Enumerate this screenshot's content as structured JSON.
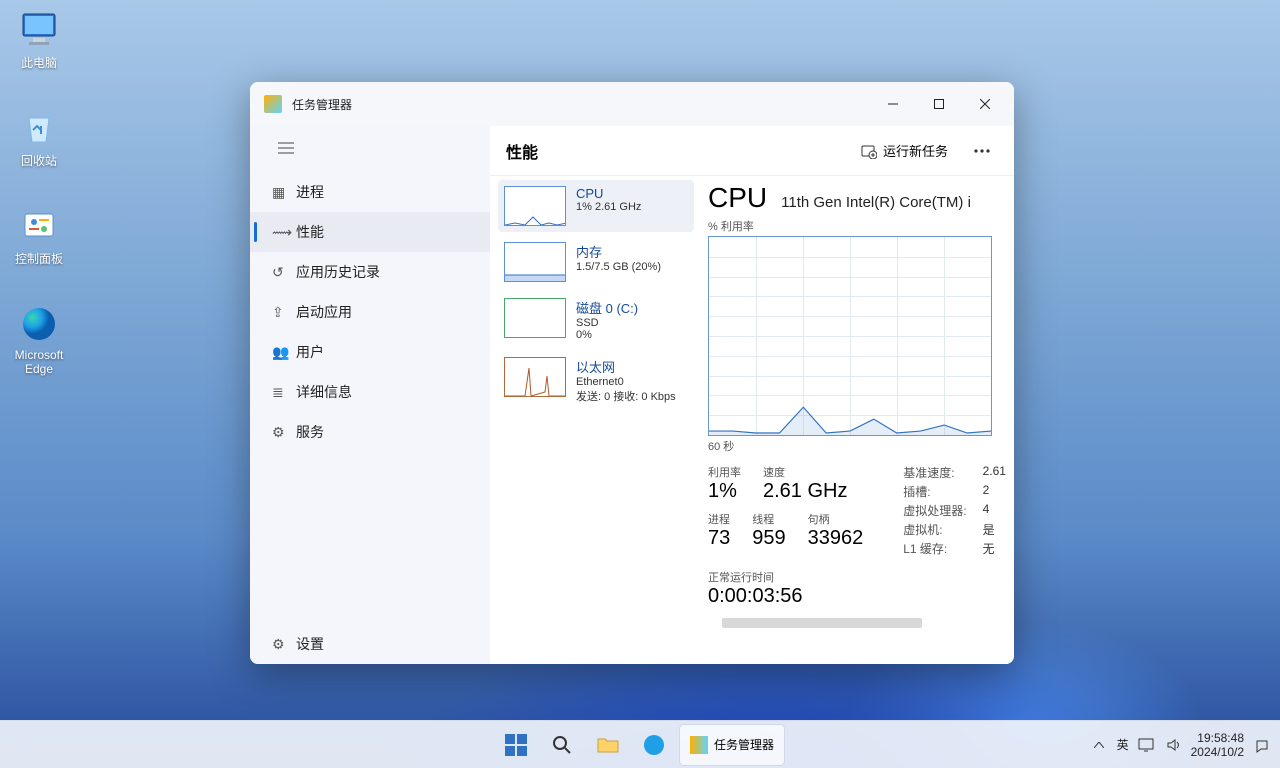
{
  "desktop_icons": {
    "computer": "此电脑",
    "recycle": "回收站",
    "panel": "控制面板",
    "edge": "Microsoft Edge"
  },
  "window": {
    "title": "任务管理器"
  },
  "sidebar": {
    "items": [
      {
        "label": "进程"
      },
      {
        "label": "性能"
      },
      {
        "label": "应用历史记录"
      },
      {
        "label": "启动应用"
      },
      {
        "label": "用户"
      },
      {
        "label": "详细信息"
      },
      {
        "label": "服务"
      }
    ],
    "settings": "设置"
  },
  "content": {
    "header_title": "性能",
    "new_task": "运行新任务"
  },
  "resources": {
    "cpu": {
      "name": "CPU",
      "sub": "1%  2.61 GHz"
    },
    "mem": {
      "name": "内存",
      "sub": "1.5/7.5 GB (20%)"
    },
    "disk": {
      "name": "磁盘 0 (C:)",
      "sub1": "SSD",
      "sub2": "0%"
    },
    "eth": {
      "name": "以太网",
      "sub1": "Ethernet0",
      "sub2": "发送: 0  接收: 0 Kbps"
    }
  },
  "detail": {
    "title": "CPU",
    "cpu_name": "11th Gen Intel(R) Core(TM) i",
    "pct_label": "% 利用率",
    "sixty": "60 秒",
    "util_label": "利用率",
    "util_value": "1%",
    "speed_label": "速度",
    "speed_value": "2.61 GHz",
    "proc_label": "进程",
    "proc_value": "73",
    "thread_label": "线程",
    "thread_value": "959",
    "handle_label": "句柄",
    "handle_value": "33962",
    "uptime_label": "正常运行时间",
    "uptime_value": "0:00:03:56",
    "kv": {
      "base_label": "基准速度:",
      "base_value": "2.61",
      "sockets_label": "插槽:",
      "sockets_value": "2",
      "lp_label": "虚拟处理器:",
      "lp_value": "4",
      "vm_label": "虚拟机:",
      "vm_value": "是",
      "l1_label": "L1 缓存:",
      "l1_value": "无"
    }
  },
  "taskbar": {
    "ime": "英",
    "running_app": "任务管理器",
    "time": "19:58:48",
    "date": "2024/10/2"
  },
  "chart_data": {
    "type": "line",
    "title": "CPU % 利用率",
    "xlabel": "最近 60 秒",
    "ylabel": "% 利用率",
    "ylim": [
      0,
      100
    ],
    "x": [
      0,
      5,
      10,
      15,
      20,
      25,
      30,
      35,
      40,
      45,
      50,
      55,
      60
    ],
    "series": [
      {
        "name": "CPU 利用率",
        "values": [
          2,
          2,
          1,
          1,
          14,
          1,
          2,
          8,
          1,
          2,
          5,
          1,
          2
        ]
      }
    ]
  }
}
